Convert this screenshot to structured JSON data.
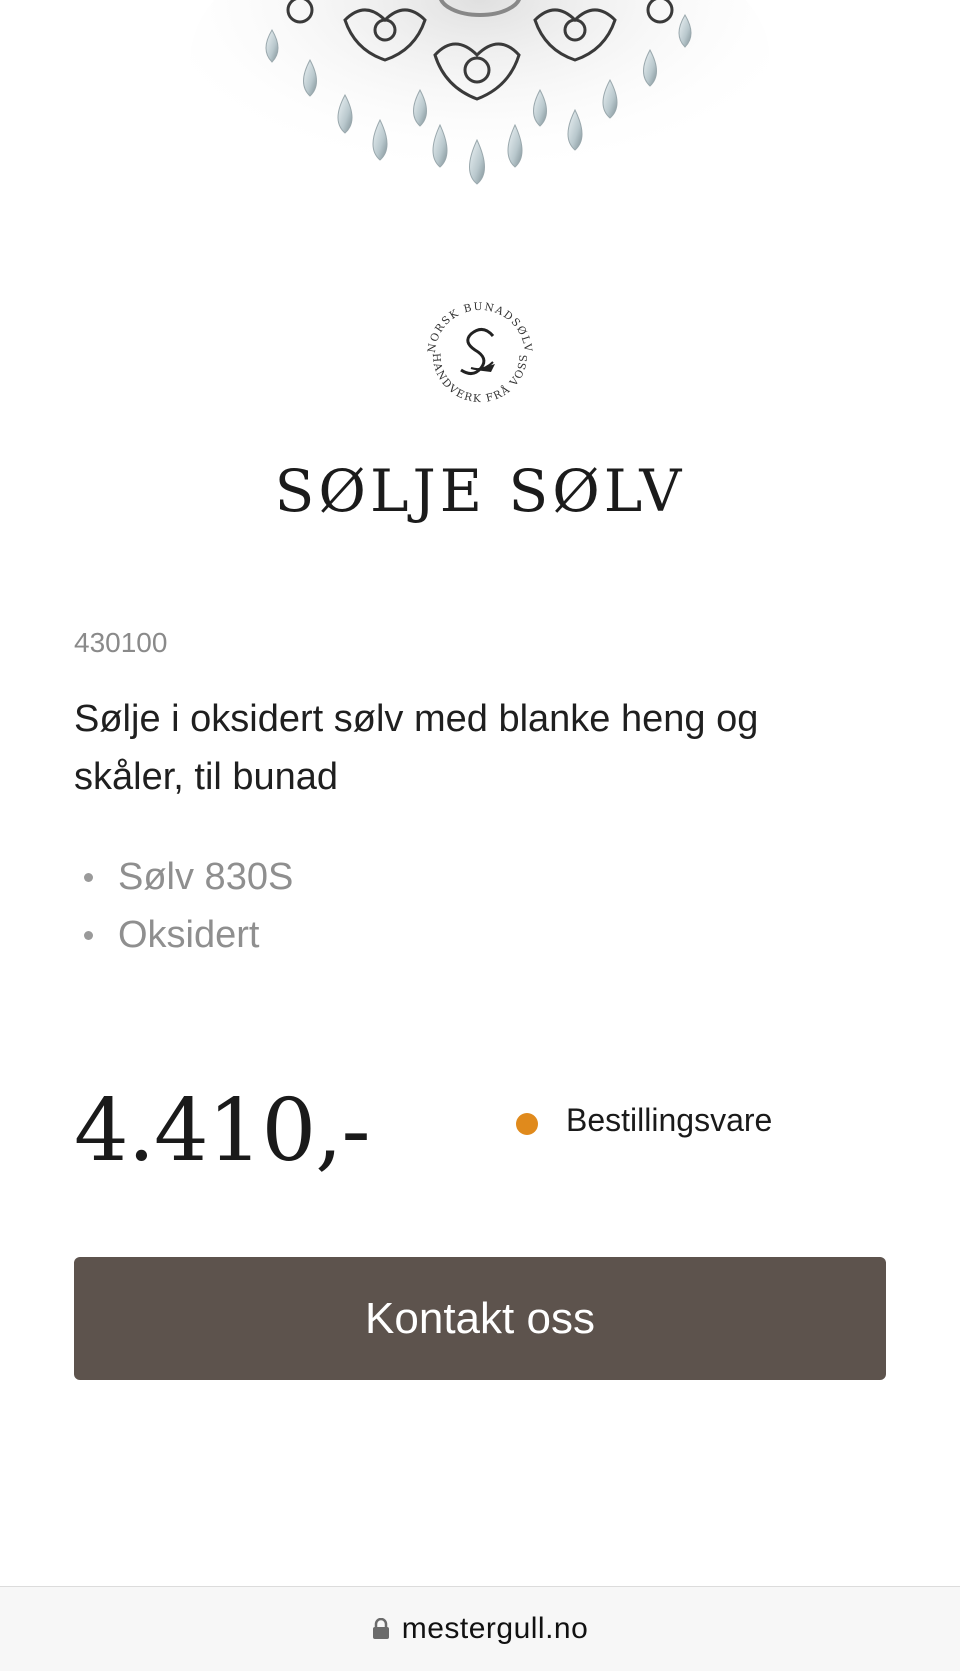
{
  "hero": {
    "image": "product-photo-solje-pendants"
  },
  "brand": {
    "logo_top_text": "NORSK BUNADSØLV",
    "logo_bottom_text": "HANDVERK FRÅ VOSS",
    "name": "SØLJE SØLV"
  },
  "product": {
    "sku": "430100",
    "title": "Sølje i oksidert sølv med blanke heng og skåler, til bunad",
    "features": [
      "Sølv 830S",
      "Oksidert"
    ],
    "price": "4.410,-",
    "availability": "Bestillingsvare",
    "availability_color": "#e08a1c"
  },
  "actions": {
    "contact_label": "Kontakt oss",
    "button_color": "#5d534d"
  },
  "browser": {
    "url": "mestergull.no",
    "lock_icon": "lock-icon"
  }
}
